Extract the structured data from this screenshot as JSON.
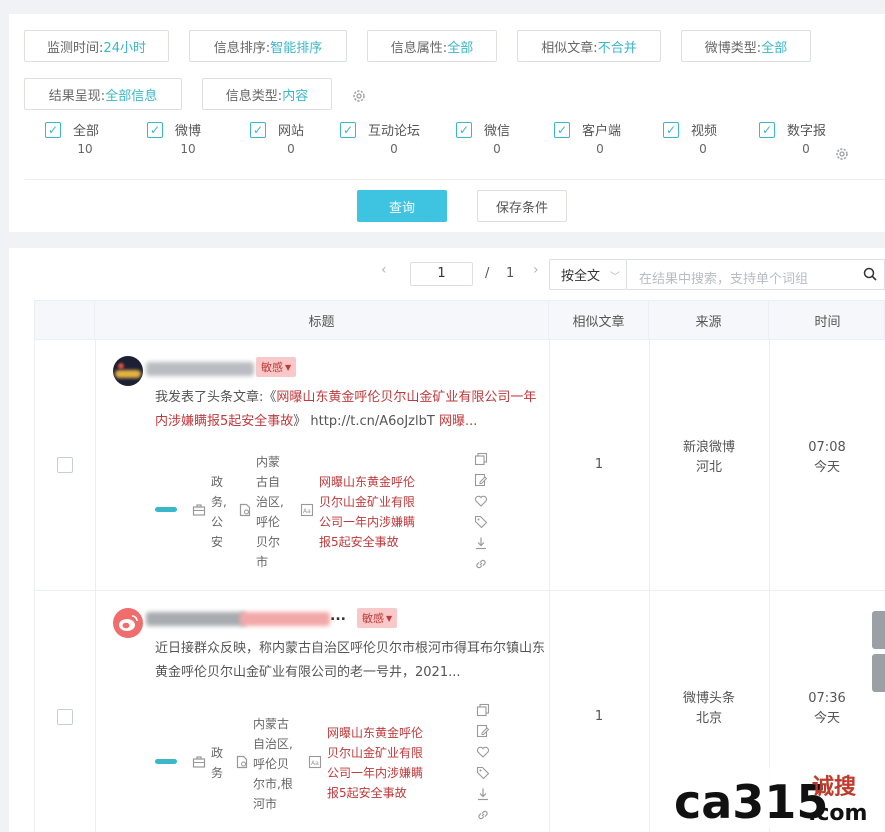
{
  "filters": {
    "monitor_time": {
      "label": "监测时间:",
      "value": "24小时"
    },
    "sort": {
      "label": "信息排序:",
      "value": "智能排序"
    },
    "attribute": {
      "label": "信息属性:",
      "value": "全部"
    },
    "similar": {
      "label": "相似文章:",
      "value": "不合并"
    },
    "weibo_type": {
      "label": "微博类型:",
      "value": "全部"
    },
    "result_mode": {
      "label": "结果呈现:",
      "value": "全部信息"
    },
    "info_type": {
      "label": "信息类型:",
      "value": "内容"
    }
  },
  "categories": [
    {
      "label": "全部",
      "count": "10"
    },
    {
      "label": "微博",
      "count": "10"
    },
    {
      "label": "网站",
      "count": "0"
    },
    {
      "label": "互动论坛",
      "count": "0"
    },
    {
      "label": "微信",
      "count": "0"
    },
    {
      "label": "客户端",
      "count": "0"
    },
    {
      "label": "视频",
      "count": "0"
    },
    {
      "label": "数字报",
      "count": "0"
    }
  ],
  "buttons": {
    "query": "查询",
    "save": "保存条件"
  },
  "pager": {
    "current": "1",
    "separator": "/",
    "total": "1"
  },
  "search": {
    "mode": "按全文",
    "placeholder": "在结果中搜索，支持单个词组"
  },
  "table": {
    "headers": {
      "title": "标题",
      "similar": "相似文章",
      "source": "来源",
      "time": "时间"
    }
  },
  "rows": [
    {
      "tag": "敏感",
      "summary_prefix": "我发表了头条文章:《",
      "summary_hl": "网曝山东黄金呼伦贝尔山金矿业有限公司一年内涉嫌瞒报5起安全事故",
      "summary_suffix": "》 http://t.cn/A6oJzlbT  ",
      "summary_tail": "网曝...",
      "meta_domain": [
        "政",
        "务,",
        "公",
        "安"
      ],
      "meta_region": [
        "内蒙",
        "古自",
        "治区,",
        "呼伦",
        "贝尔",
        "市"
      ],
      "meta_keyword": [
        "网曝山东黄金呼伦",
        "贝尔山金矿业有限",
        "公司一年内涉嫌瞒",
        "报5起安全事故"
      ],
      "similar": "1",
      "source_name": "新浪微博",
      "source_region": "河北",
      "time": "07:08",
      "day": "今天"
    },
    {
      "tag": "敏感",
      "title_tail": "...",
      "summary_prefix": "近日接群众反映，称内蒙古自治区呼伦贝尔市根河市得耳布尔镇山东黄金呼伦贝尔山金矿业有限公司的老一号井，2021...",
      "meta_domain": [
        "政",
        "务"
      ],
      "meta_region": [
        "内蒙古",
        "自治区,",
        "呼伦贝",
        "尔市,根",
        "河市"
      ],
      "meta_keyword": [
        "网曝山东黄金呼伦",
        "贝尔山金矿业有限",
        "公司一年内涉嫌瞒",
        "报5起安全事故"
      ],
      "similar": "1",
      "source_name": "微博头条",
      "source_region": "北京",
      "time": "07:36",
      "day": "今天"
    }
  ],
  "watermark": {
    "brand": "ca315",
    "cn": "诚搜",
    "domain": ".com"
  }
}
